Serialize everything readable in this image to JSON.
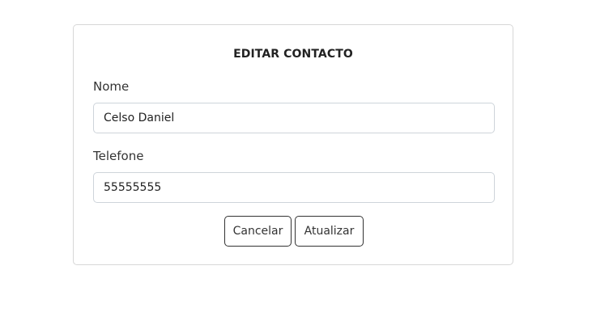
{
  "form": {
    "title": "EDITAR CONTACTO",
    "nome": {
      "label": "Nome",
      "value": "Celso Daniel"
    },
    "telefone": {
      "label": "Telefone",
      "value": "55555555"
    }
  },
  "actions": {
    "cancel_label": "Cancelar",
    "update_label": "Atualizar"
  }
}
